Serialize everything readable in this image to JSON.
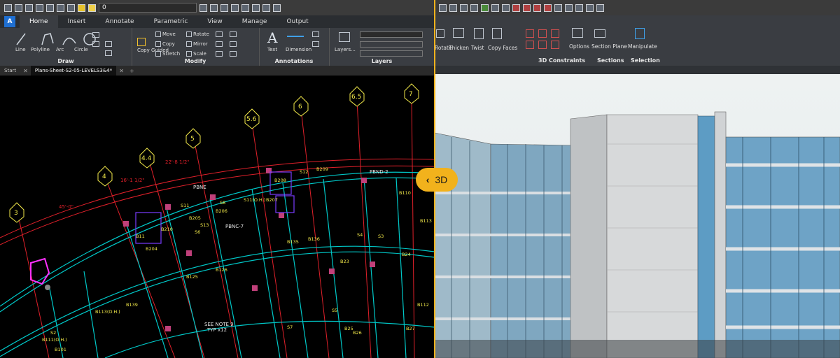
{
  "compare_toggle": {
    "label": "3D"
  },
  "left_app": {
    "layer_value": "0",
    "tabs": [
      "Home",
      "Insert",
      "Annotate",
      "Parametric",
      "View",
      "Manage",
      "Output"
    ],
    "active_tab": "Home",
    "groups": {
      "draw": {
        "label": "Draw",
        "tools": [
          "Line",
          "Polyline",
          "Arc",
          "Circle"
        ]
      },
      "modify": {
        "label": "Modify",
        "tools": [
          "Move",
          "Copy",
          "Stretch",
          "Rotate",
          "Mirror",
          "Scale",
          "Copy Guided"
        ]
      },
      "annotations": {
        "label": "Annotations",
        "tools": [
          "Text",
          "Dimension"
        ]
      },
      "layers": {
        "label": "Layers",
        "tools": [
          "Layers..."
        ]
      }
    },
    "doc_tabs": [
      "Start",
      "Plans-Sheet-S2-05-LEVELS3&4*"
    ],
    "accent": "#1f6fd1"
  },
  "drawing": {
    "grid_bubbles": [
      "3",
      "4",
      "4.4",
      "5",
      "5.6",
      "6",
      "6.5",
      "7"
    ],
    "line_labels": [
      "PBNE",
      "PBND-2",
      "PBNC-7"
    ],
    "dimension_labels": [
      "45'-0\"",
      "16'-1 1/2\"",
      "22'-8 1/2\""
    ],
    "beam_labels": [
      "B11",
      "B204",
      "B210",
      "B205",
      "B206",
      "B207",
      "B208",
      "B209",
      "B23",
      "B24",
      "B25",
      "B26",
      "B27",
      "B110",
      "B112",
      "B113",
      "B125",
      "B126",
      "B135",
      "B136",
      "B139",
      "B113(O.H.)",
      "B111(O.H.)",
      "B101",
      "S2",
      "S3",
      "S4",
      "S5",
      "S6",
      "S7",
      "S8",
      "S11",
      "S11(O.H.)",
      "S12",
      "S13"
    ],
    "note_lines": [
      "SEE NOTE 9",
      "TYP x12"
    ]
  },
  "right_app": {
    "tools": [
      "Rotate",
      "Thicken",
      "Twist",
      "Copy Faces",
      "Options",
      "Section Plane",
      "Manipulate"
    ],
    "groups": [
      "3D Constraints",
      "Sections",
      "Selection"
    ]
  },
  "colors": {
    "highlight": "#f2b21c",
    "grid": "#e0202a",
    "beam_outline": "#00c8c8",
    "label": "#f2e94a"
  }
}
